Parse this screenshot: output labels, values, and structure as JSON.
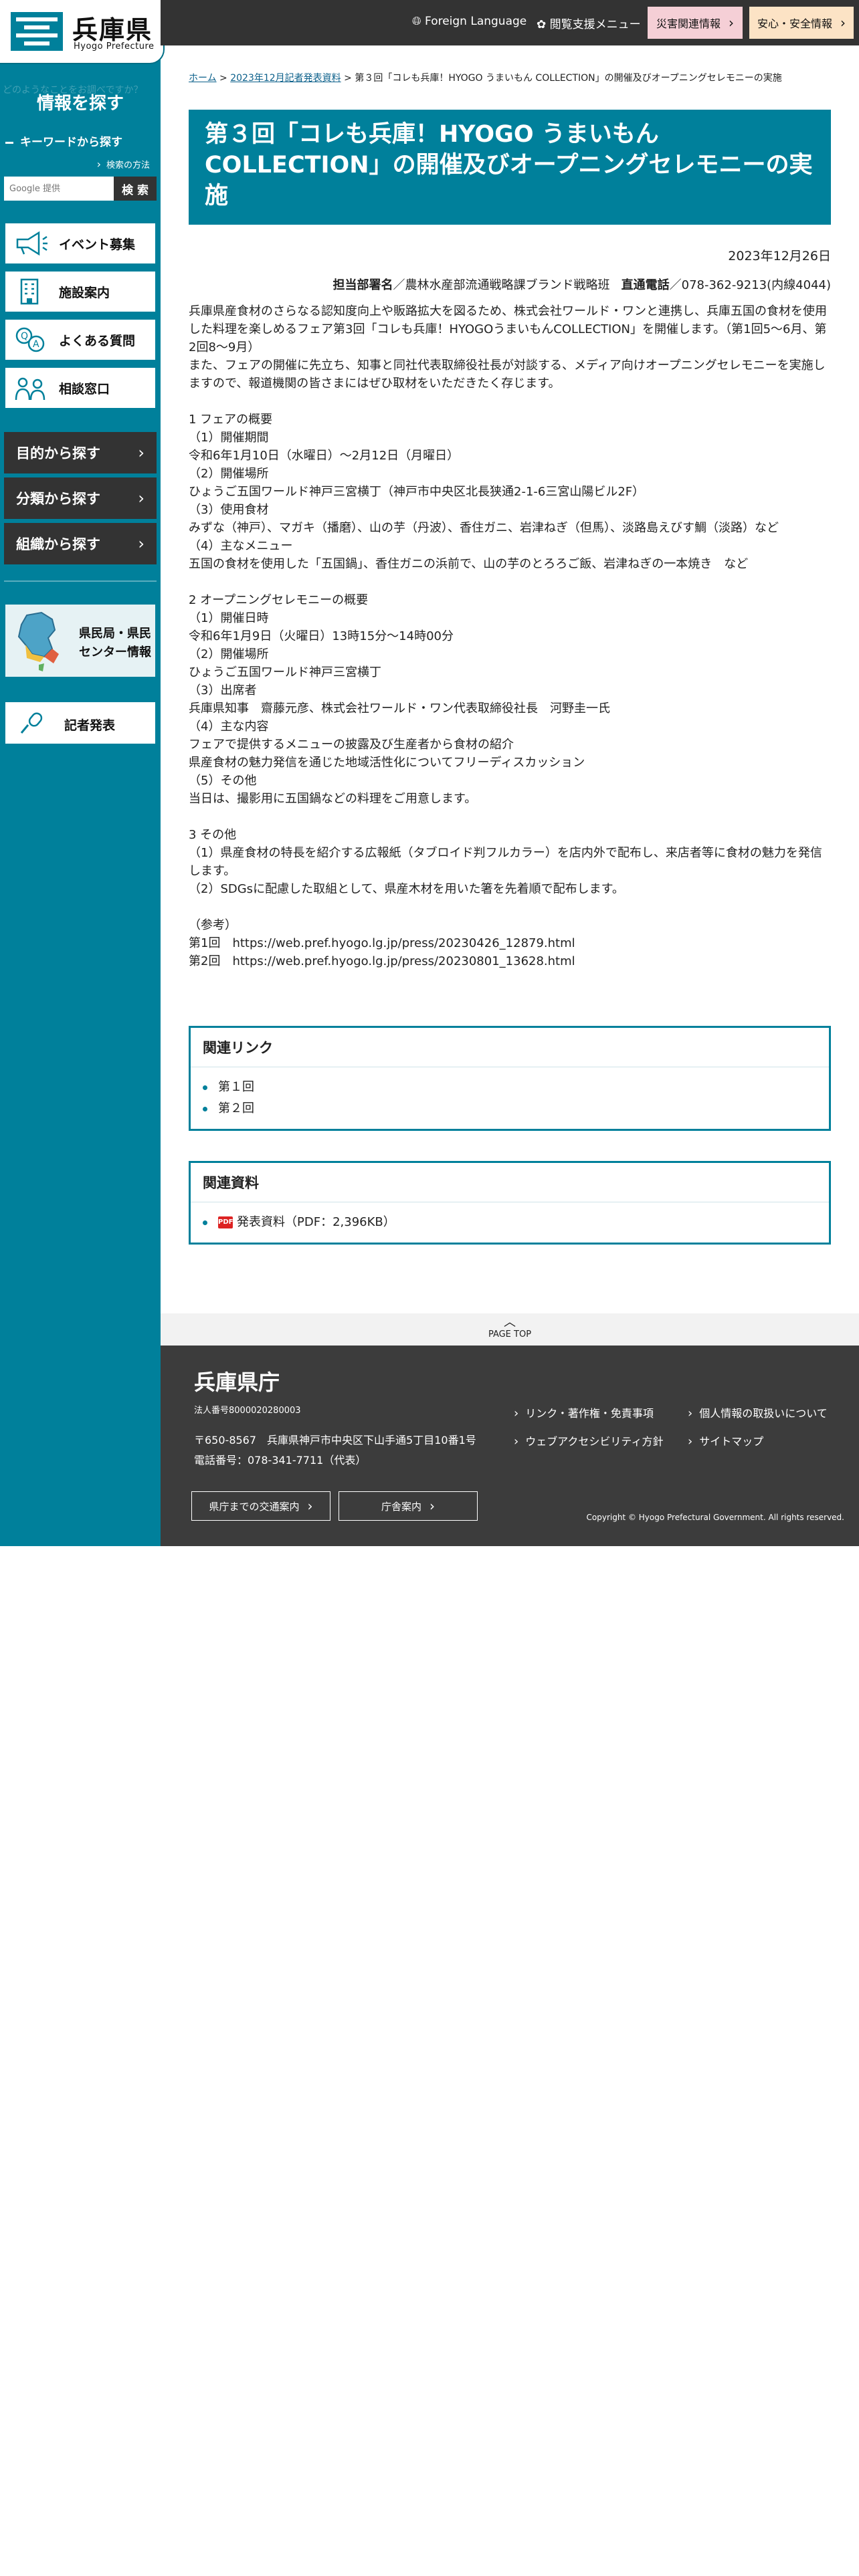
{
  "sidebar": {
    "logo_name": "兵庫県",
    "logo_sub": "Hyogo Prefecture",
    "faint_text": "どのようなことをお調べですか？",
    "title": "情報を探す",
    "keyword_heading": "キーワードから探す",
    "search_how": "検索の方法",
    "search_placeholder": "Google 提供",
    "search_button": "検 索",
    "quick_links": [
      "イベント募集",
      "施設案内",
      "よくある質問",
      "相談窓口"
    ],
    "browse": [
      "目的から探す",
      "分類から探す",
      "組織から探す"
    ],
    "center_label_1": "県民局・県民",
    "center_label_2": "センター情報",
    "press_label": "記者発表"
  },
  "header": {
    "lang": "Foreign Language",
    "access": "閲覧支援メニュー",
    "disaster": "災害関連情報",
    "safety": "安心・安全情報"
  },
  "breadcrumb": {
    "home": "ホーム",
    "sep": " > ",
    "parent": "2023年12月記者発表資料",
    "current": "第３回「コレも兵庫！HYOGO うまいもん COLLECTION」の開催及びオープニングセレモニーの実施"
  },
  "article": {
    "title": "第３回「コレも兵庫！HYOGO うまいもん COLLECTION」の開催及びオープニングセレモニーの実施",
    "date": "2023年12月26日",
    "dept_label": "担当部署名",
    "dept_value": "／農林水産部流通戦略課ブランド戦略班",
    "tel_label": "直通電話",
    "tel_value": "／078-362-9213(内線4044)",
    "body": [
      "兵庫県産食材のさらなる認知度向上や販路拡大を図るため、株式会社ワールド・ワンと連携し、兵庫五国の食材を使用",
      "した料理を楽しめるフェア第3回「コレも兵庫！HYOGOうまいもんCOLLECTION」を開催します。（第1回5～6月、第",
      "2回8～9月）",
      "また、フェアの開催に先立ち、知事と同社代表取締役社長が対談する、メディア向けオープニングセレモニーを実施し",
      "ますので、報道機関の皆さまにはぜひ取材をいただきたく存じます。",
      "",
      "1 フェアの概要",
      "（1）開催期間",
      "令和6年1月10日（水曜日）～2月12日（月曜日）",
      "（2）開催場所",
      "ひょうご五国ワールド神戸三宮横丁（神戸市中央区北長狭通2-1-6三宮山陽ビル2F）",
      "（3）使用食材",
      "みずな（神戸）、マガキ（播磨）、山の芋（丹波）、香住ガニ、岩津ねぎ（但馬）、淡路島えびす鯛（淡路）など",
      "（4）主なメニュー",
      "五国の食材を使用した「五国鍋」、香住ガニの浜前で、山の芋のとろろご飯、岩津ねぎの一本焼き　など",
      "",
      "2 オープニングセレモニーの概要",
      "（1）開催日時",
      "令和6年1月9日（火曜日）13時15分～14時00分",
      "（2）開催場所",
      "ひょうご五国ワールド神戸三宮横丁",
      "（3）出席者",
      "兵庫県知事　齋藤元彦、株式会社ワールド・ワン代表取締役社長　河野圭一氏",
      "（4）主な内容",
      "フェアで提供するメニューの披露及び生産者から食材の紹介",
      "県産食材の魅力発信を通じた地域活性化についてフリーディスカッション",
      "（5）その他",
      "当日は、撮影用に五国鍋などの料理をご用意します。",
      "",
      "3 その他",
      "（1）県産食材の特長を紹介する広報紙（タブロイド判フルカラー）を店内外で配布し、来店者等に食材の魅力を発信",
      "します。",
      "（2）SDGsに配慮した取組として、県産木材を用いた箸を先着順で配布します。",
      "",
      "（参考）",
      "第1回　https://web.pref.hyogo.lg.jp/press/20230426_12879.html",
      "第2回　https://web.pref.hyogo.lg.jp/press/20230801_13628.html"
    ]
  },
  "related_links": {
    "heading": "関連リンク",
    "items": [
      "第１回",
      "第２回"
    ]
  },
  "related_docs": {
    "heading": "関連資料",
    "pdf_badge": "PDF",
    "item": "発表資料（PDF：2,396KB）"
  },
  "pagetop": "PAGE TOP",
  "footer": {
    "name": "兵庫県庁",
    "corp_no": "法人番号8000020280003",
    "address": "〒650-8567　兵庫県神戸市中央区下山手通5丁目10番1号",
    "tel": "電話番号：078-341-7711（代表）",
    "access_btn": "県庁までの交通案内",
    "building_btn": "庁舎案内",
    "links": [
      "リンク・著作権・免責事項",
      "個人情報の取扱いについて",
      "ウェブアクセシビリティ方針",
      "サイトマップ"
    ],
    "copyright": "Copyright © Hyogo Prefectural Government. All rights reserved."
  },
  "colors": {
    "primary": "#00809b",
    "dark": "#333333",
    "disaster": "#f5cfd6",
    "safety": "#fce3c5"
  }
}
